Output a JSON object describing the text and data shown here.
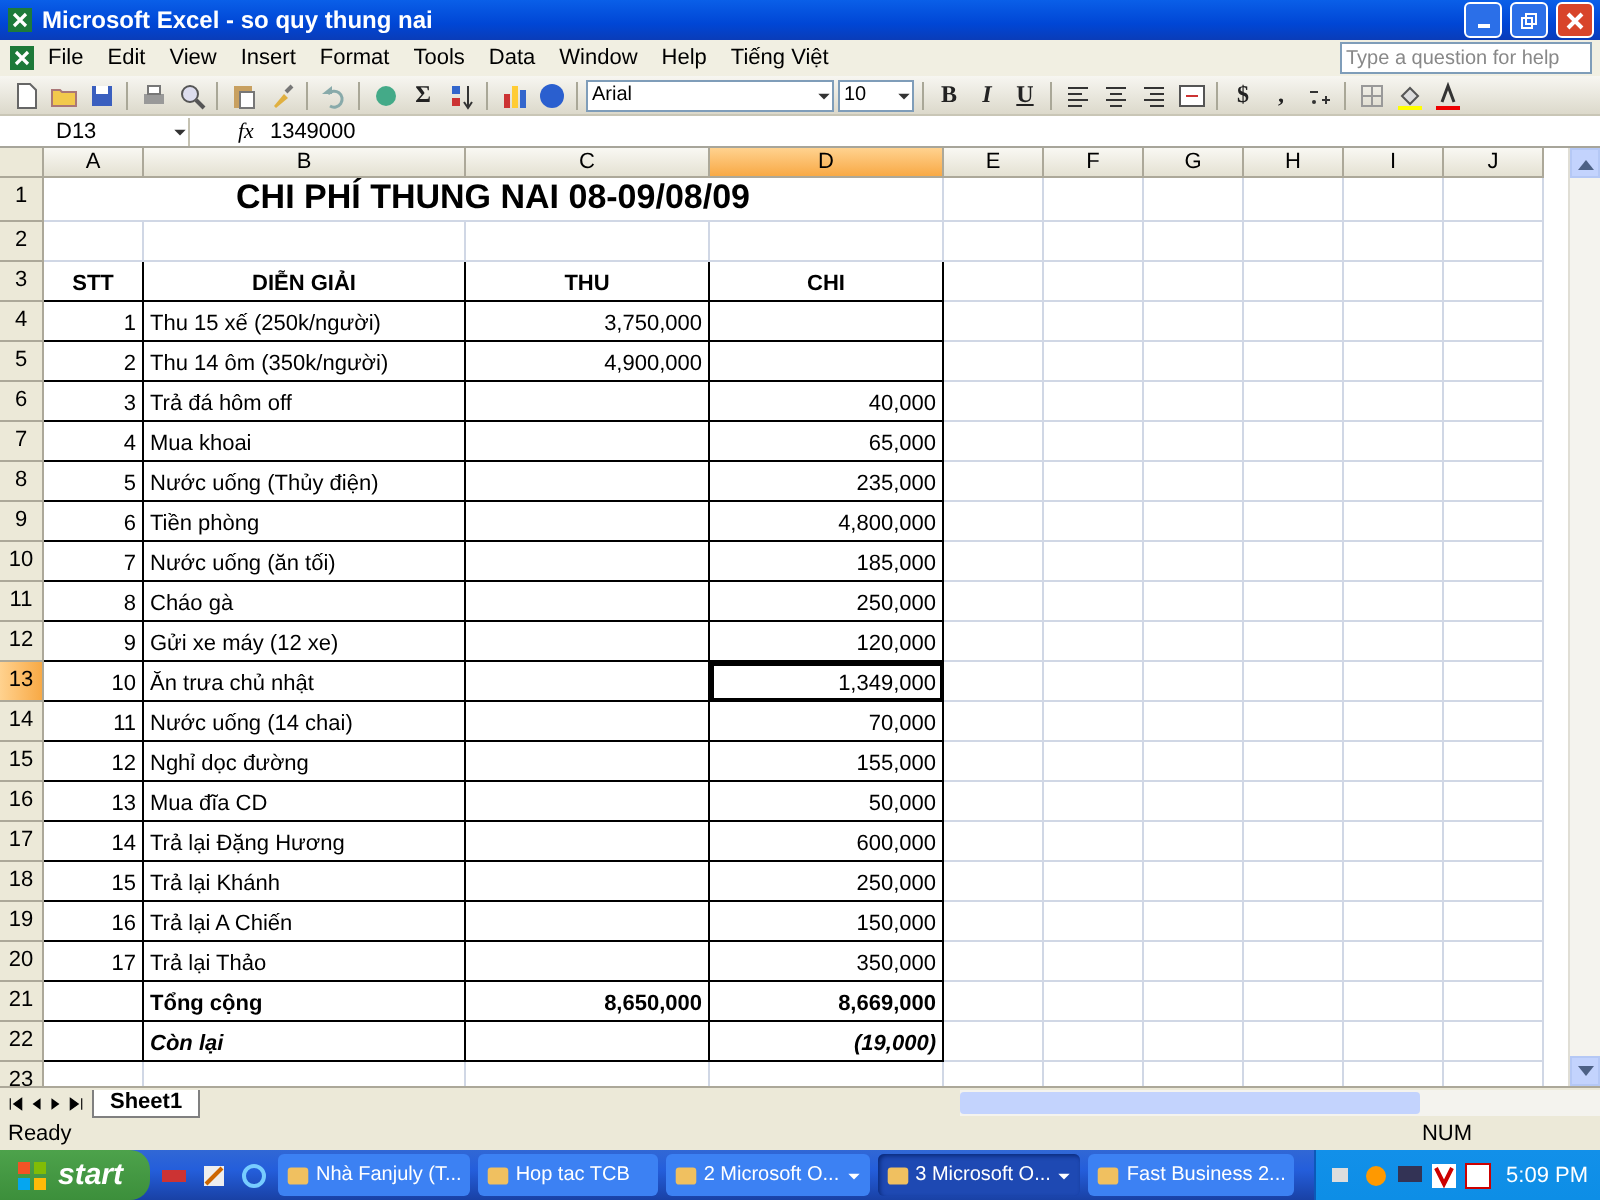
{
  "window": {
    "title": "Microsoft Excel - so quy thung nai"
  },
  "menu": [
    "File",
    "Edit",
    "View",
    "Insert",
    "Format",
    "Tools",
    "Data",
    "Window",
    "Help",
    "Tiếng Việt"
  ],
  "help": {
    "placeholder": "Type a question for help"
  },
  "standard_toolbar": {
    "sum": "Σ"
  },
  "format_toolbar": {
    "font": "Arial",
    "size": "10",
    "bold": "B",
    "italic": "I",
    "underline": "U",
    "currency": "$",
    "comma": ","
  },
  "formula_bar": {
    "name_box": "D13",
    "fx": "fx",
    "value": "1349000"
  },
  "columns": [
    {
      "label": "A",
      "selected": false
    },
    {
      "label": "B",
      "selected": false
    },
    {
      "label": "C",
      "selected": false
    },
    {
      "label": "D",
      "selected": true
    },
    {
      "label": "E",
      "selected": false
    },
    {
      "label": "F",
      "selected": false
    },
    {
      "label": "G",
      "selected": false
    },
    {
      "label": "H",
      "selected": false
    },
    {
      "label": "I",
      "selected": false
    },
    {
      "label": "J",
      "selected": false
    }
  ],
  "rows": [
    {
      "number": "1",
      "kind": "title",
      "selected": false,
      "cells": [
        "CHI PHÍ THUNG NAI 08-09/08/09"
      ]
    },
    {
      "number": "2",
      "kind": "blank",
      "selected": false,
      "cells": []
    },
    {
      "number": "3",
      "kind": "header",
      "selected": false,
      "cells": [
        "STT",
        "DIỄN GIẢI",
        "THU",
        "CHI"
      ]
    },
    {
      "number": "4",
      "kind": "item",
      "selected": false,
      "cells": [
        "1",
        "Thu 15 xế (250k/người)",
        "3,750,000",
        ""
      ]
    },
    {
      "number": "5",
      "kind": "item",
      "selected": false,
      "cells": [
        "2",
        "Thu 14 ôm (350k/người)",
        "4,900,000",
        ""
      ]
    },
    {
      "number": "6",
      "kind": "item",
      "selected": false,
      "cells": [
        "3",
        "Trả đá hôm off",
        "",
        "40,000"
      ]
    },
    {
      "number": "7",
      "kind": "item",
      "selected": false,
      "cells": [
        "4",
        "Mua khoai",
        "",
        "65,000"
      ]
    },
    {
      "number": "8",
      "kind": "item",
      "selected": false,
      "cells": [
        "5",
        "Nước uống (Thủy điện)",
        "",
        "235,000"
      ]
    },
    {
      "number": "9",
      "kind": "item",
      "selected": false,
      "cells": [
        "6",
        "Tiền phòng",
        "",
        "4,800,000"
      ]
    },
    {
      "number": "10",
      "kind": "item",
      "selected": false,
      "cells": [
        "7",
        "Nước uống (ăn tối)",
        "",
        "185,000"
      ]
    },
    {
      "number": "11",
      "kind": "item",
      "selected": false,
      "cells": [
        "8",
        "Cháo gà",
        "",
        "250,000"
      ]
    },
    {
      "number": "12",
      "kind": "item",
      "selected": false,
      "cells": [
        "9",
        "Gửi xe máy (12 xe)",
        "",
        "120,000"
      ]
    },
    {
      "number": "13",
      "kind": "item",
      "selected": true,
      "cells": [
        "10",
        "Ăn trưa chủ nhật",
        "",
        "1,349,000"
      ]
    },
    {
      "number": "14",
      "kind": "item",
      "selected": false,
      "cells": [
        "11",
        "Nước uống (14 chai)",
        "",
        "70,000"
      ]
    },
    {
      "number": "15",
      "kind": "item",
      "selected": false,
      "cells": [
        "12",
        "Nghỉ dọc đường",
        "",
        "155,000"
      ]
    },
    {
      "number": "16",
      "kind": "item",
      "selected": false,
      "cells": [
        "13",
        "Mua đĩa CD",
        "",
        "50,000"
      ]
    },
    {
      "number": "17",
      "kind": "item",
      "selected": false,
      "cells": [
        "14",
        "Trả lại Đặng Hương",
        "",
        "600,000"
      ]
    },
    {
      "number": "18",
      "kind": "item",
      "selected": false,
      "cells": [
        "15",
        "Trả lại Khánh",
        "",
        "250,000"
      ]
    },
    {
      "number": "19",
      "kind": "item",
      "selected": false,
      "cells": [
        "16",
        "Trả lại A Chiến",
        "",
        "150,000"
      ]
    },
    {
      "number": "20",
      "kind": "item",
      "selected": false,
      "cells": [
        "17",
        "Trả lại Thảo",
        "",
        "350,000"
      ]
    },
    {
      "number": "21",
      "kind": "total",
      "selected": false,
      "cells": [
        "",
        "Tổng cộng",
        "8,650,000",
        "8,669,000"
      ]
    },
    {
      "number": "22",
      "kind": "remainder",
      "selected": false,
      "cells": [
        "",
        "Còn lại",
        "",
        "(19,000)"
      ]
    },
    {
      "number": "23",
      "kind": "blank",
      "selected": false,
      "cells": []
    }
  ],
  "sheet_tabs": [
    {
      "label": "Sheet1",
      "selected": true
    }
  ],
  "status_bar": {
    "status": "Ready",
    "indicator": "NUM"
  },
  "taskbar": {
    "start": "start",
    "tasks": [
      {
        "label": "Nhà Fanjuly (T...",
        "selected": false,
        "dropdown": false
      },
      {
        "label": "Hop tac TCB",
        "selected": false,
        "dropdown": false
      },
      {
        "label": "2 Microsoft O...",
        "selected": false,
        "dropdown": true
      },
      {
        "label": "3 Microsoft O...",
        "selected": true,
        "dropdown": true
      },
      {
        "label": "Fast Business 2...",
        "selected": false,
        "dropdown": false
      }
    ],
    "clock": "5:09 PM"
  }
}
